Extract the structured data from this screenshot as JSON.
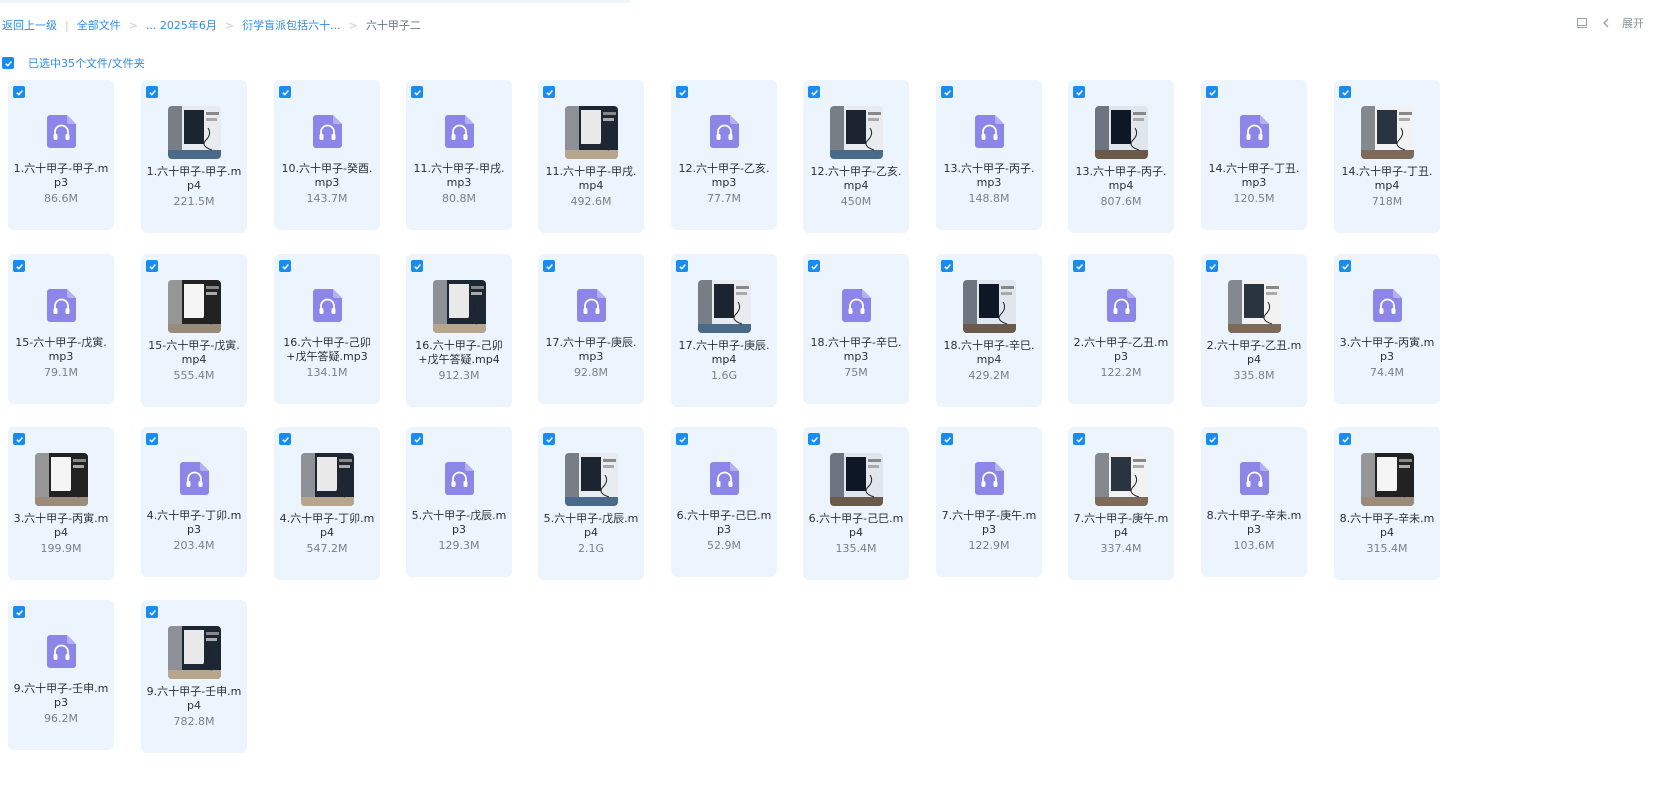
{
  "breadcrumb": {
    "back": "返回上一级",
    "items": [
      "全部文件",
      "... 2025年6月",
      "衍学盲派包括六十...",
      "六十甲子二"
    ]
  },
  "toolbar": {
    "expand_label": "展开"
  },
  "selection": {
    "label": "已选中35个文件/文件夹"
  },
  "colors": {
    "accent": "#1a8cf0",
    "card_bg": "#ecf5fd",
    "audio_icon": "#8b86e8"
  },
  "files": [
    {
      "name": "1.六十甲子-甲子.mp3",
      "size": "86.6M",
      "type": "audio",
      "checked": true
    },
    {
      "name": "1.六十甲子-甲子.mp4",
      "size": "221.5M",
      "type": "video",
      "checked": true
    },
    {
      "name": "10.六十甲子-癸酉.mp3",
      "size": "143.7M",
      "type": "audio",
      "checked": true
    },
    {
      "name": "11.六十甲子-甲戌.mp3",
      "size": "80.8M",
      "type": "audio",
      "checked": true
    },
    {
      "name": "11.六十甲子-甲戌.mp4",
      "size": "492.6M",
      "type": "video",
      "checked": true
    },
    {
      "name": "12.六十甲子-乙亥.mp3",
      "size": "77.7M",
      "type": "audio",
      "checked": true
    },
    {
      "name": "12.六十甲子-乙亥.mp4",
      "size": "450M",
      "type": "video",
      "checked": true
    },
    {
      "name": "13.六十甲子-丙子.mp3",
      "size": "148.8M",
      "type": "audio",
      "checked": true
    },
    {
      "name": "13.六十甲子-丙子.mp4",
      "size": "807.6M",
      "type": "video",
      "checked": true
    },
    {
      "name": "14.六十甲子-丁丑.mp3",
      "size": "120.5M",
      "type": "audio",
      "checked": true
    },
    {
      "name": "14.六十甲子-丁丑.mp4",
      "size": "718M",
      "type": "video",
      "checked": true
    },
    {
      "name": "15-六十甲子-戊寅.mp3",
      "size": "79.1M",
      "type": "audio",
      "checked": true
    },
    {
      "name": "15-六十甲子-戊寅.mp4",
      "size": "555.4M",
      "type": "video",
      "checked": true
    },
    {
      "name": "16.六十甲子-己卯+戊午答疑.mp3",
      "size": "134.1M",
      "type": "audio",
      "checked": true
    },
    {
      "name": "16.六十甲子-己卯+戊午答疑.mp4",
      "size": "912.3M",
      "type": "video",
      "checked": true
    },
    {
      "name": "17.六十甲子-庚辰.mp3",
      "size": "92.8M",
      "type": "audio",
      "checked": true
    },
    {
      "name": "17.六十甲子-庚辰.mp4",
      "size": "1.6G",
      "type": "video",
      "checked": true
    },
    {
      "name": "18.六十甲子-辛巳.mp3",
      "size": "75M",
      "type": "audio",
      "checked": true
    },
    {
      "name": "18.六十甲子-辛巳.mp4",
      "size": "429.2M",
      "type": "video",
      "checked": true
    },
    {
      "name": "2.六十甲子-乙丑.mp3",
      "size": "122.2M",
      "type": "audio",
      "checked": true
    },
    {
      "name": "2.六十甲子-乙丑.mp4",
      "size": "335.8M",
      "type": "video",
      "checked": true
    },
    {
      "name": "3.六十甲子-丙寅.mp3",
      "size": "74.4M",
      "type": "audio",
      "checked": true
    },
    {
      "name": "3.六十甲子-丙寅.mp4",
      "size": "199.9M",
      "type": "video",
      "checked": true
    },
    {
      "name": "4.六十甲子-丁卯.mp3",
      "size": "203.4M",
      "type": "audio",
      "checked": true
    },
    {
      "name": "4.六十甲子-丁卯.mp4",
      "size": "547.2M",
      "type": "video",
      "checked": true
    },
    {
      "name": "5.六十甲子-戊辰.mp3",
      "size": "129.3M",
      "type": "audio",
      "checked": true
    },
    {
      "name": "5.六十甲子-戊辰.mp4",
      "size": "2.1G",
      "type": "video",
      "checked": true
    },
    {
      "name": "6.六十甲子-己巳.mp3",
      "size": "52.9M",
      "type": "audio",
      "checked": true
    },
    {
      "name": "6.六十甲子-己巳.mp4",
      "size": "135.4M",
      "type": "video",
      "checked": true
    },
    {
      "name": "7.六十甲子-庚午.mp3",
      "size": "122.9M",
      "type": "audio",
      "checked": true
    },
    {
      "name": "7.六十甲子-庚午.mp4",
      "size": "337.4M",
      "type": "video",
      "checked": true
    },
    {
      "name": "8.六十甲子-辛未.mp3",
      "size": "103.6M",
      "type": "audio",
      "checked": true
    },
    {
      "name": "8.六十甲子-辛未.mp4",
      "size": "315.4M",
      "type": "video",
      "checked": true
    },
    {
      "name": "9.六十甲子-壬申.mp3",
      "size": "96.2M",
      "type": "audio",
      "checked": true
    },
    {
      "name": "9.六十甲子-壬申.mp4",
      "size": "782.8M",
      "type": "video",
      "checked": true
    }
  ]
}
